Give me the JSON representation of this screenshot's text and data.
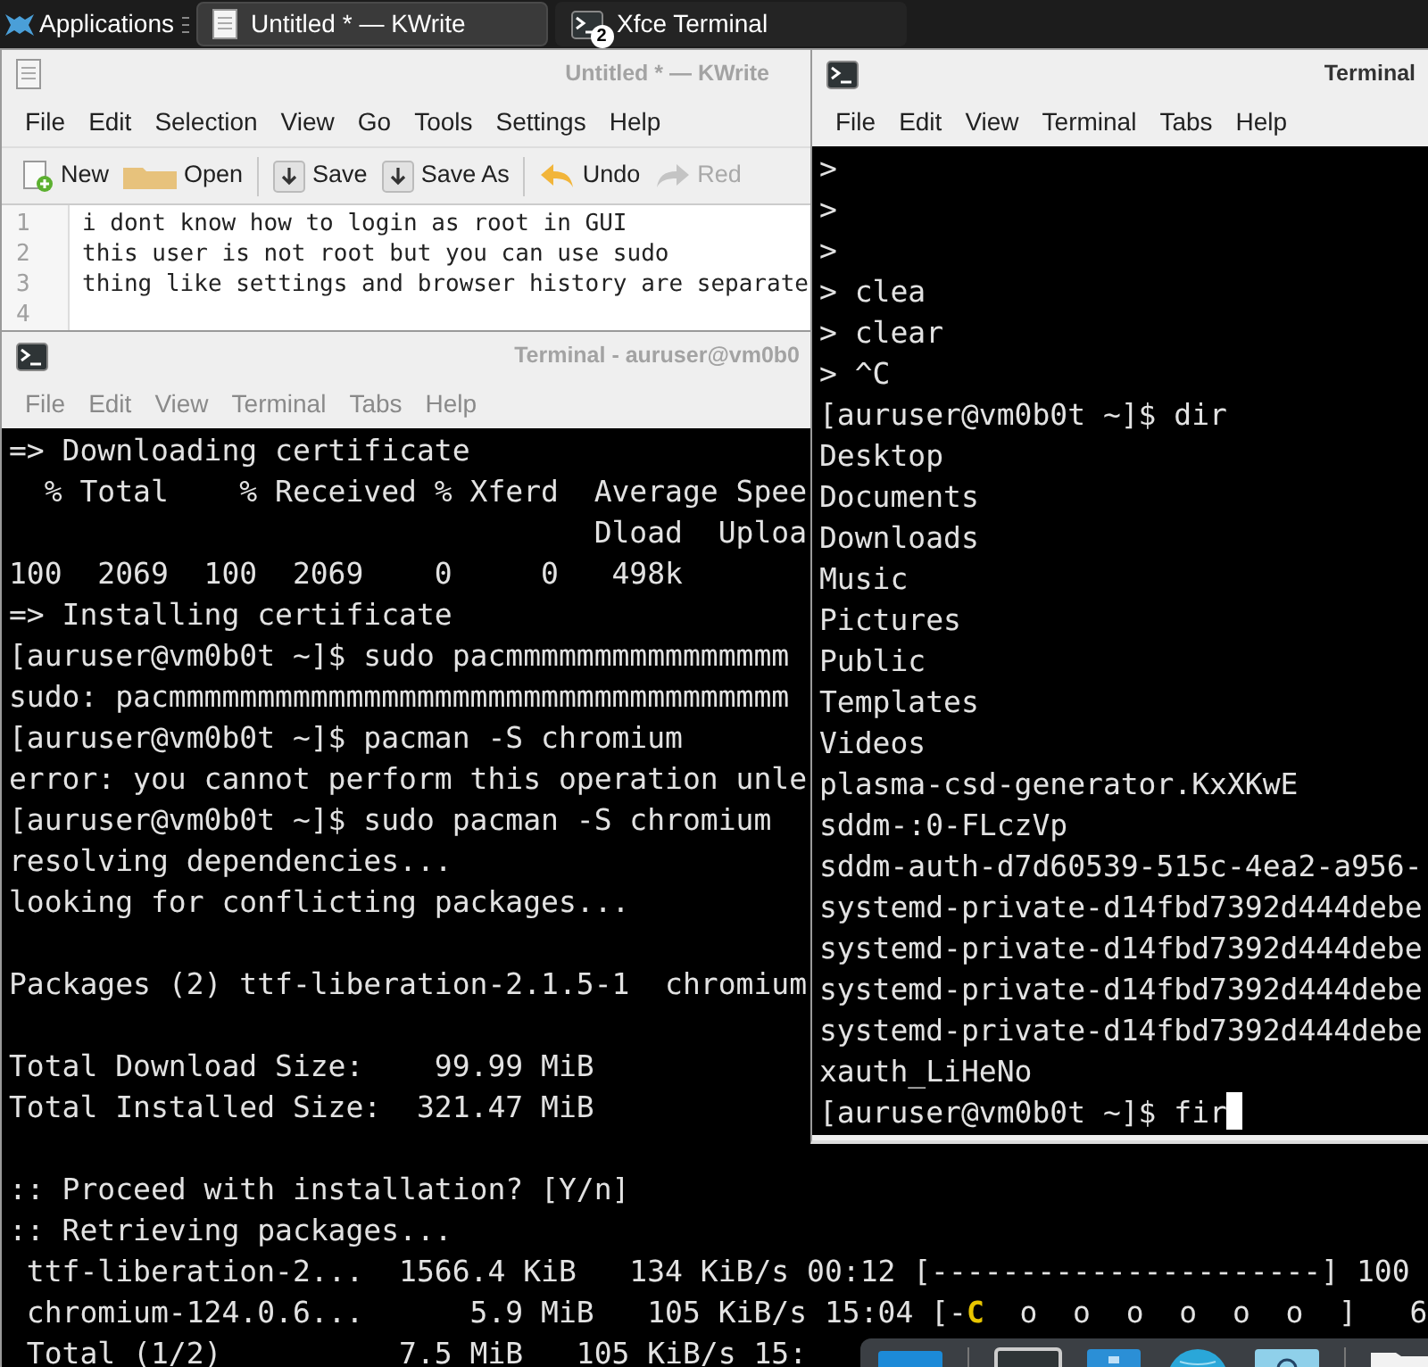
{
  "panel": {
    "menu_label": "Applications",
    "tasks": [
      {
        "title": "Untitled * — KWrite",
        "kind": "document",
        "selected": true
      },
      {
        "title": "Xfce Terminal",
        "kind": "terminal",
        "badge": "2",
        "selected": false
      }
    ]
  },
  "kwrite": {
    "title": "Untitled * — KWrite",
    "active": false,
    "menu": [
      "File",
      "Edit",
      "Selection",
      "View",
      "Go",
      "Tools",
      "Settings",
      "Help"
    ],
    "toolbar": [
      {
        "kind": "new",
        "label": "New",
        "disabled": false
      },
      {
        "kind": "open",
        "label": "Open",
        "disabled": false
      },
      {
        "kind": "separator"
      },
      {
        "kind": "save",
        "label": "Save",
        "disabled": false
      },
      {
        "kind": "save-as",
        "label": "Save As",
        "disabled": false
      },
      {
        "kind": "separator"
      },
      {
        "kind": "undo",
        "label": "Undo",
        "disabled": false
      },
      {
        "kind": "redo",
        "label": "Red",
        "disabled": true
      }
    ],
    "lines": [
      {
        "number": "1",
        "text": "i dont know how to login as root in GUI"
      },
      {
        "number": "2",
        "text": "this user is not root but you can use sudo"
      },
      {
        "number": "3",
        "text": "thing like settings and browser history are separate"
      },
      {
        "number": "4"
      }
    ]
  },
  "terminal_back": {
    "title": "Terminal - auruser@vm0b0",
    "active": false,
    "menu": [
      "File",
      "Edit",
      "View",
      "Terminal",
      "Tabs",
      "Help"
    ],
    "lines": [
      {
        "text": "=> Downloading certificate"
      },
      {
        "text": "  % Total    % Received % Xferd  Average Spee"
      },
      {
        "text": "                                 Dload  Uploa"
      },
      {
        "text": "100  2069  100  2069    0     0   498k"
      },
      {
        "text": "=> Installing certificate"
      },
      {
        "text": "[auruser@vm0b0t ~]$ sudo pacmmmmmmmmmmmmmmmm"
      },
      {
        "text": "sudo: pacmmmmmmmmmmmmmmmmmmmmmmmmmmmmmmmmmmm"
      },
      {
        "text": "[auruser@vm0b0t ~]$ pacman -S chromium"
      },
      {
        "text": "error: you cannot perform this operation unle"
      },
      {
        "text": "[auruser@vm0b0t ~]$ sudo pacman -S chromium"
      },
      {
        "text": "resolving dependencies..."
      },
      {
        "text": "looking for conflicting packages..."
      },
      {
        "kind": "blank"
      },
      {
        "text": "Packages (2) ttf-liberation-2.1.5-1  chromium"
      },
      {
        "kind": "blank"
      },
      {
        "text": "Total Download Size:    99.99 MiB"
      },
      {
        "text": "Total Installed Size:  321.47 MiB"
      },
      {
        "kind": "blank"
      },
      {
        "text": ":: Proceed with installation? [Y/n]"
      },
      {
        "text": ":: Retrieving packages..."
      },
      {
        "text": " ttf-liberation-2...  1566.4 KiB   134 KiB/s 00:12 [----------------------] 100"
      },
      {
        "text": " chromium-124.0.6...      5.9 MiB   105 KiB/s 15:04 [-**C**  o  o  o  o  o  o  ]   6"
      },
      {
        "text": " Total (1/2)          7.5 MiB   105 KiB/s 15:"
      }
    ]
  },
  "terminal_front": {
    "title": "Terminal",
    "active": true,
    "cursor": true,
    "menu": [
      "File",
      "Edit",
      "View",
      "Terminal",
      "Tabs",
      "Help"
    ],
    "lines": [
      {
        "text": ">"
      },
      {
        "text": ">"
      },
      {
        "text": ">"
      },
      {
        "text": "> clea"
      },
      {
        "text": "> clear"
      },
      {
        "text": "> ^C"
      },
      {
        "text": "[auruser@vm0b0t ~]$ dir"
      },
      {
        "text": "Desktop"
      },
      {
        "text": "Documents"
      },
      {
        "text": "Downloads"
      },
      {
        "text": "Music"
      },
      {
        "text": "Pictures"
      },
      {
        "text": "Public"
      },
      {
        "text": "Templates"
      },
      {
        "text": "Videos"
      },
      {
        "text": "plasma-csd-generator.KxXKwE"
      },
      {
        "text": "sddm-:0-FLczVp"
      },
      {
        "text": "sddm-auth-d7d60539-515c-4ea2-a956-"
      },
      {
        "text": "systemd-private-d14fbd7392d444debe"
      },
      {
        "text": "systemd-private-d14fbd7392d444debe"
      },
      {
        "text": "systemd-private-d14fbd7392d444debe"
      },
      {
        "text": "systemd-private-d14fbd7392d444debe"
      },
      {
        "text": "xauth_LiHeNo"
      },
      {
        "text": "[auruser@vm0b0t ~]$ fir"
      }
    ]
  }
}
